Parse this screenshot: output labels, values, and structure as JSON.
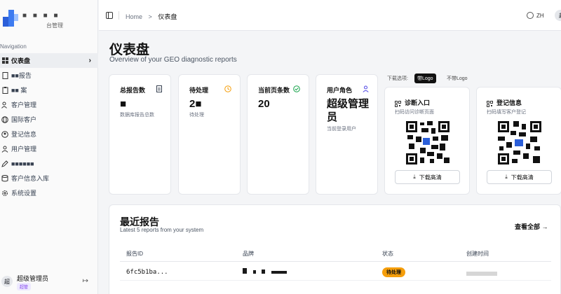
{
  "brand": {
    "name": "■ ■ ■ ■",
    "sub": "台管理"
  },
  "sidebar": {
    "section_title": "Navigation",
    "items": [
      {
        "label": "仪表盘",
        "icon": "grid-icon",
        "active": true
      },
      {
        "label": "■■报告",
        "icon": "file-icon"
      },
      {
        "label": "■■ 案",
        "icon": "clipboard-icon"
      },
      {
        "label": "客户管理",
        "icon": "users-icon"
      },
      {
        "label": "国际客户",
        "icon": "globe-icon"
      },
      {
        "label": "登记信息",
        "icon": "id-icon"
      },
      {
        "label": "用户管理",
        "icon": "user-icon"
      },
      {
        "label": "■■■■■■",
        "icon": "pen-icon"
      },
      {
        "label": "客户信息入库",
        "icon": "database-icon"
      },
      {
        "label": "系统设置",
        "icon": "gear-icon"
      }
    ]
  },
  "user": {
    "avatar": "超",
    "name": "超级管理员",
    "role": "超管"
  },
  "topbar": {
    "home": "Home",
    "separator": ">",
    "current": "仪表盘",
    "lang": "ZH",
    "avatar": "超"
  },
  "page": {
    "title": "仪表盘",
    "subtitle": "Overview of your GEO diagnostic reports"
  },
  "cards": [
    {
      "title": "总报告数",
      "value": "■",
      "sub": "数据库报告总数",
      "icon": "doc-icon",
      "color": "#374151"
    },
    {
      "title": "待处理",
      "value": "2■",
      "sub": "待处理",
      "icon": "clock-icon",
      "color": "#f59e0b"
    },
    {
      "title": "当前页条数",
      "value": "20",
      "sub": "",
      "icon": "check-icon",
      "color": "#16a34a"
    },
    {
      "title": "用户角色",
      "value": "超级管理员",
      "sub": "当前登录用户",
      "icon": "person-icon",
      "color": "#4f46e5"
    }
  ],
  "download": {
    "label": "下载选项:",
    "with_logo": "带Logo",
    "without_logo": "不带Logo"
  },
  "qr_cards": [
    {
      "title": "诊断入口",
      "sub": "扫码访问诊断页面",
      "button": "下载高清"
    },
    {
      "title": "登记信息",
      "sub": "扫码填写客户登记",
      "button": "下载高清"
    }
  ],
  "recent": {
    "title": "最近报告",
    "subtitle": "Latest 5 reports from your system",
    "view_all": "查看全部 →",
    "columns": [
      "报告ID",
      "品牌",
      "状态",
      "创建时间"
    ],
    "rows": [
      {
        "id": "6fc5b1ba...",
        "status": "待处理"
      }
    ]
  }
}
